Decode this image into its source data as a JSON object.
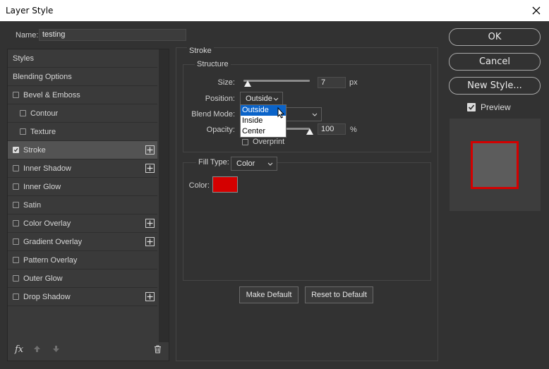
{
  "window": {
    "title": "Layer Style"
  },
  "name": {
    "label": "Name:",
    "value": "testing"
  },
  "styles_panel": {
    "items": [
      {
        "label": "Styles"
      },
      {
        "label": "Blending Options"
      },
      {
        "label": "Bevel & Emboss",
        "checked": false
      },
      {
        "label": "Contour",
        "checked": false
      },
      {
        "label": "Texture",
        "checked": false
      },
      {
        "label": "Stroke",
        "checked": true,
        "selected": true,
        "addable": true
      },
      {
        "label": "Inner Shadow",
        "checked": false,
        "addable": true
      },
      {
        "label": "Inner Glow",
        "checked": false
      },
      {
        "label": "Satin",
        "checked": false
      },
      {
        "label": "Color Overlay",
        "checked": false,
        "addable": true
      },
      {
        "label": "Gradient Overlay",
        "checked": false,
        "addable": true
      },
      {
        "label": "Pattern Overlay",
        "checked": false
      },
      {
        "label": "Outer Glow",
        "checked": false
      },
      {
        "label": "Drop Shadow",
        "checked": false,
        "addable": true
      }
    ],
    "footer_icons": [
      "fx-icon",
      "arrow-up-icon",
      "arrow-down-icon",
      "trash-icon"
    ]
  },
  "stroke": {
    "title": "Stroke",
    "structure": {
      "title": "Structure",
      "size_label": "Size:",
      "size_value": "7",
      "size_unit": "px",
      "position_label": "Position:",
      "position_value": "Outside",
      "position_options": [
        "Outside",
        "Inside",
        "Center"
      ],
      "blend_label": "Blend Mode:",
      "opacity_label": "Opacity:",
      "opacity_value": "100",
      "opacity_unit": "%",
      "overprint_label": "Overprint",
      "overprint_checked": false
    },
    "fill": {
      "type_label": "Fill Type:",
      "type_value": "Color",
      "color_label": "Color:",
      "color": "#d40000"
    },
    "make_default": "Make Default",
    "reset_default": "Reset to Default"
  },
  "buttons": {
    "ok": "OK",
    "cancel": "Cancel",
    "new_style": "New Style..."
  },
  "preview": {
    "label": "Preview",
    "checked": true,
    "fill": "#5c5c5c",
    "stroke": "#d40000"
  }
}
